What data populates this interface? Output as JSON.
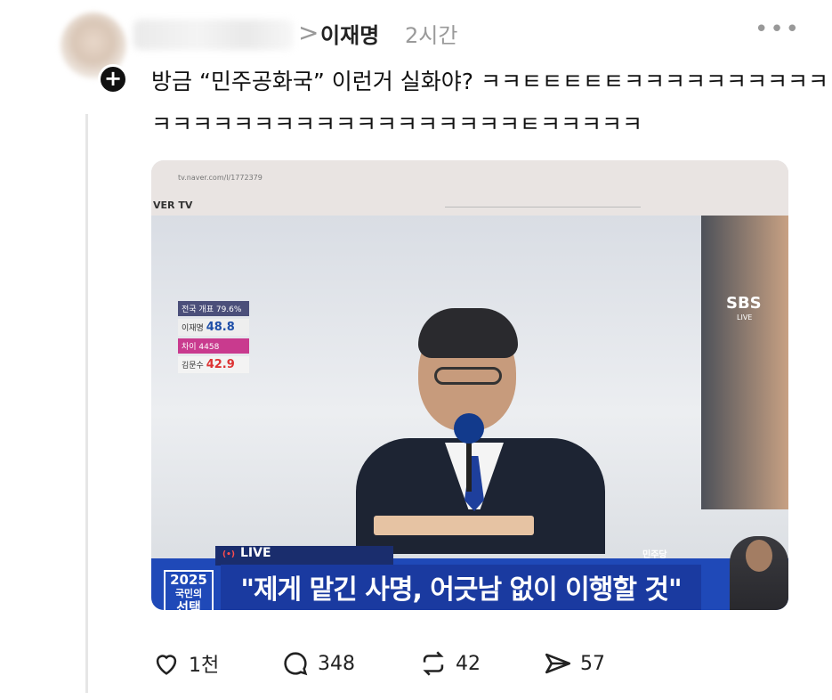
{
  "header": {
    "author": "이재명",
    "time": "2시간",
    "more": "•••",
    "chevron": ">"
  },
  "post": {
    "line1": "방금 “민주공화국” 이런거 실화야? ㅋㅋㅌㅌㅌㅌㅌㅋㅋㅋㅋㅋㅋㅋㅋㅋㅋ",
    "line2": "ㅋㅋㅋㅋㅋㅋㅋㅋㅋㅋㅋㅋㅋㅋㅋㅋㅋㅋㅌㅋㅋㅋㅋㅋ"
  },
  "media": {
    "browser_logo": "VER TV",
    "channel": "SBS",
    "channel_sub": "LIVE",
    "scoreboard": {
      "row1": "전국 개표 79.6%",
      "row2_name": "이재명",
      "row2_pct": "48.8",
      "row3": "차이 4458",
      "row4_name": "김문수",
      "row4_pct": "42.9"
    },
    "live_label": "LIVE",
    "party": "민주당",
    "badge_year": "2025",
    "badge_line2": "국민의",
    "badge_line3": "선택",
    "caption": "\"제게 맡긴 사명, 어긋남 없이 이행할 것\""
  },
  "actions": {
    "likes": "1천",
    "comments": "348",
    "reposts": "42",
    "shares": "57"
  },
  "icons": [
    "heart-icon",
    "comment-icon",
    "repost-icon",
    "share-icon",
    "more-icon",
    "follow-plus-icon"
  ]
}
